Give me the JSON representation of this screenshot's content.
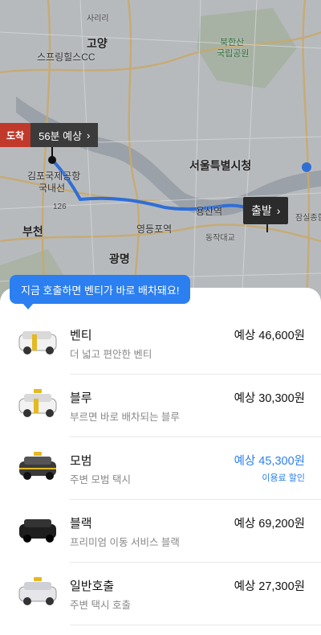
{
  "map": {
    "labels": {
      "sariri": "사리리",
      "goyang": "고양",
      "sports_cc": "스프링힐스CC",
      "bukhansan": "북한산",
      "national_park": "국립공원",
      "gimpo_airport": "김포국제공항",
      "domestic": "국내선",
      "seoul_city_hall": "서울특별시청",
      "yongsan": "용산역",
      "yeongdeungpo": "영등포역",
      "bucheon": "부천",
      "gwangmyeong": "광명",
      "jamsil": "잠실종합운동장",
      "dongjak": "동작대교",
      "route_126": "126"
    },
    "destination_badge": "도착",
    "eta_label": "56분 예상",
    "start_label": "출발"
  },
  "tooltip": "지금 호출하면 벤티가 바로 배차돼요!",
  "options": [
    {
      "name": "벤티",
      "desc": "더 넓고 편안한 벤티",
      "price": "예상 46,600원",
      "highlight": false,
      "car": "venti-car-icon",
      "car_color": "#f2f2f2",
      "roof": "#e5b91f"
    },
    {
      "name": "블루",
      "desc": "부르면 바로 배차되는 블루",
      "price": "예상 30,300원",
      "highlight": false,
      "car": "blue-taxi-icon",
      "car_color": "#f2f2f2",
      "roof": "#e5b91f"
    },
    {
      "name": "모범",
      "desc": "주변 모범 택시",
      "price": "예상 45,300원",
      "highlight": true,
      "discount": "이용료 할인",
      "car": "deluxe-taxi-icon",
      "car_color": "#3a3a3a",
      "roof": "#e5b91f"
    },
    {
      "name": "블랙",
      "desc": "프리미엄 이동 서비스 블랙",
      "price": "예상 69,200원",
      "highlight": false,
      "car": "black-car-icon",
      "car_color": "#1e1e1e",
      "roof": ""
    },
    {
      "name": "일반호출",
      "desc": "주변 택시 호출",
      "price": "예상 27,300원",
      "highlight": false,
      "car": "regular-taxi-icon",
      "car_color": "#e6e6ea",
      "roof": "#e5b91f"
    }
  ],
  "colors": {
    "accent": "#2b7ff0",
    "route": "#2f6ed6",
    "destination": "#c0392b"
  }
}
